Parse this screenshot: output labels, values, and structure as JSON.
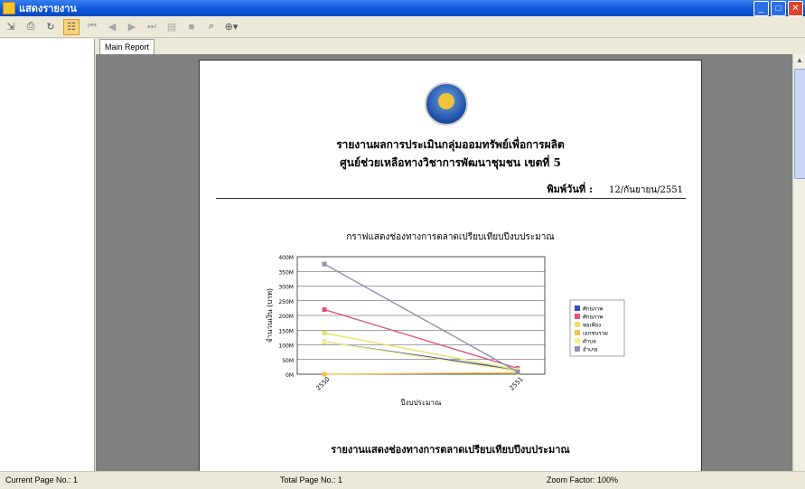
{
  "window": {
    "title": "แสดงรายงาน"
  },
  "toolbar": {
    "icons": [
      "export-icon",
      "print-icon",
      "refresh-icon",
      "group-tree-icon",
      "first-page-icon",
      "prev-page-icon",
      "next-page-icon",
      "last-page-icon",
      "goto-page-icon",
      "stop-icon",
      "search-icon",
      "zoom-icon"
    ]
  },
  "tabs": [
    {
      "label": "Main Report"
    }
  ],
  "report": {
    "title_line1": "รายงานผลการประเมินกลุ่มออมทรัพย์เพื่อการผลิต",
    "title_line2": "ศูนย์ช่วยเหลือทางวิชาการพัฒนาชุมชน เขตที่ 5",
    "print_date_label": "พิมพ์วันที่ :",
    "print_date": "12/กันยายน/2551",
    "chart_title": "กราฟแสดงช่องทางการตลาดเปรียบเทียบปีงบประมาณ",
    "section_title": "รายงานแสดงช่องทางการตลาดเปรียบเทียบปีงบประมาณ"
  },
  "chart_data": {
    "type": "line",
    "title": "กราฟแสดงช่องทางการตลาดเปรียบเทียบปีงบประมาณ",
    "xlabel": "ปีงบประมาณ",
    "ylabel": "จำนวนเงิน (บาท)",
    "categories": [
      "2550",
      "2551"
    ],
    "ylim": [
      0,
      400
    ],
    "yticks": [
      "0M",
      "50M",
      "100M",
      "150M",
      "200M",
      "250M",
      "300M",
      "350M",
      "400M"
    ],
    "series": [
      {
        "name": "ศักยภาพ",
        "color": "#3b4fb0",
        "values": [
          110,
          15
        ]
      },
      {
        "name": "ศักยภาพ",
        "color": "#d8577a",
        "values": [
          220,
          20
        ]
      },
      {
        "name": "พอเพียง",
        "color": "#e6e26a",
        "values": [
          140,
          15
        ]
      },
      {
        "name": "เอกชนรวม",
        "color": "#f2c24c",
        "values": [
          0,
          5
        ]
      },
      {
        "name": "ตำบล",
        "color": "#f5ef8a",
        "values": [
          110,
          10
        ]
      },
      {
        "name": "อำเภอ",
        "color": "#8c90b8",
        "values": [
          375,
          8
        ]
      }
    ],
    "grid": true,
    "legend": "right"
  },
  "status": {
    "current_page": "Current Page No.: 1",
    "total_page": "Total Page No.: 1",
    "zoom": "Zoom Factor: 100%"
  }
}
